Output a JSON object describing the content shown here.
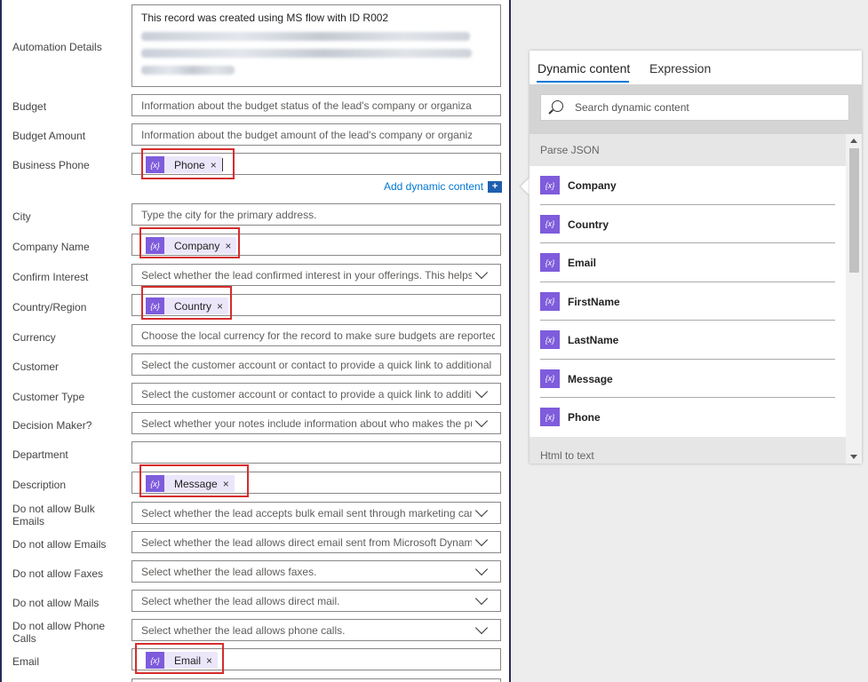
{
  "form": {
    "automation_label": "Automation Details",
    "automation_text": "This record was created using MS flow with ID R002",
    "budget_label": "Budget",
    "budget_ph": "Information about the budget status of the lead's company or organization.",
    "budget_amount_label": "Budget Amount",
    "budget_amount_ph": "Information about the budget amount of the lead's company or organization.",
    "business_phone_label": "Business Phone",
    "business_phone_token": "Phone",
    "add_dynamic": "Add dynamic content",
    "city_label": "City",
    "city_ph": "Type the city for the primary address.",
    "company_label": "Company Name",
    "company_token": "Company",
    "confirm_label": "Confirm Interest",
    "confirm_ph": "Select whether the lead confirmed interest in your offerings. This helps i",
    "country_label": "Country/Region",
    "country_token": "Country",
    "currency_label": "Currency",
    "currency_ph": "Choose the local currency for the record to make sure budgets are reported in",
    "customer_label": "Customer",
    "customer_ph": "Select the customer account or contact to provide a quick link to additional cu",
    "customer_type_label": "Customer Type",
    "customer_type_ph": "Select the customer account or contact to provide a quick link to additic",
    "decision_label": "Decision Maker?",
    "decision_ph": "Select whether your notes include information about who makes the pu",
    "department_label": "Department",
    "description_label": "Description",
    "description_token": "Message",
    "bulk_label": "Do not allow Bulk Emails",
    "bulk_ph": "Select whether the lead accepts bulk email sent through marketing cam",
    "emails_label": "Do not allow Emails",
    "emails_ph": "Select whether the lead allows direct email sent from Microsoft Dynamic",
    "faxes_label": "Do not allow Faxes",
    "faxes_ph": "Select whether the lead allows faxes.",
    "mails_label": "Do not allow Mails",
    "mails_ph": "Select whether the lead allows direct mail.",
    "phone_calls_label": "Do not allow Phone Calls",
    "phone_calls_ph": "Select whether the lead allows phone calls.",
    "email_label": "Email",
    "email_token": "Email"
  },
  "panel": {
    "tab_dynamic": "Dynamic content",
    "tab_expression": "Expression",
    "search_ph": "Search dynamic content",
    "section_parse": "Parse JSON",
    "items": [
      "Company",
      "Country",
      "Email",
      "FirstName",
      "LastName",
      "Message",
      "Phone"
    ],
    "section_html": "Html to text"
  },
  "colors": {
    "token_icon": "#7e5cdc",
    "highlight_box": "#d42d2d",
    "link": "#0078d4"
  }
}
